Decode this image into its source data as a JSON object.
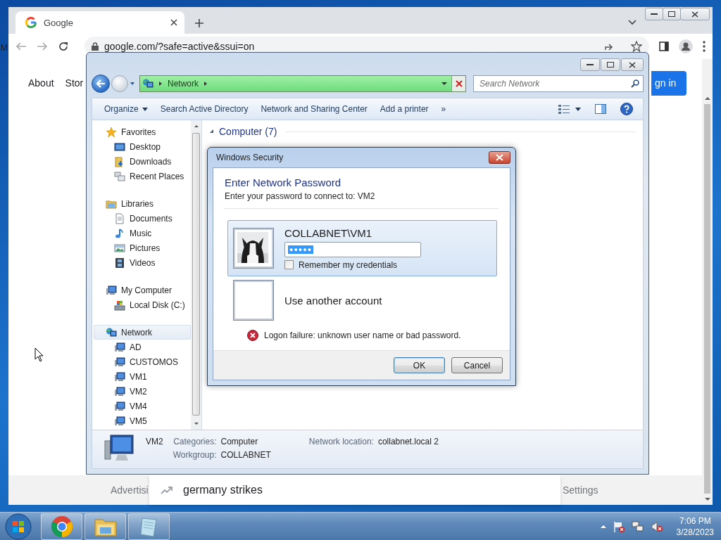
{
  "desktop": {
    "icon_label": "M"
  },
  "browser": {
    "tab_title": "Google",
    "address": "google.com/?safe=active&ssui=on",
    "nav_links": [
      "About",
      "Stor"
    ],
    "sign_in": "gn in",
    "footer_links": [
      "Advertisi",
      "Settings"
    ],
    "suggestion": "germany strikes"
  },
  "explorer": {
    "breadcrumb": "Network",
    "search_placeholder": "Search Network",
    "commands": [
      {
        "kind": "menu",
        "label": "Organize"
      },
      {
        "kind": "plain",
        "label": "Search Active Directory"
      },
      {
        "kind": "plain",
        "label": "Network and Sharing Center"
      },
      {
        "kind": "plain",
        "label": "Add a printer"
      },
      {
        "kind": "overflow",
        "label": "»"
      }
    ],
    "nav": [
      {
        "label": "Favorites",
        "kind": "star",
        "selected": false,
        "children": [
          {
            "label": "Desktop",
            "kind": "desktop",
            "selected": false
          },
          {
            "label": "Downloads",
            "kind": "downloads",
            "selected": false
          },
          {
            "label": "Recent Places",
            "kind": "recent",
            "selected": false
          }
        ]
      },
      {
        "label": "Libraries",
        "kind": "libraries",
        "selected": false,
        "children": [
          {
            "label": "Documents",
            "kind": "document",
            "selected": false
          },
          {
            "label": "Music",
            "kind": "music",
            "selected": false
          },
          {
            "label": "Pictures",
            "kind": "pictures",
            "selected": false
          },
          {
            "label": "Videos",
            "kind": "videos",
            "selected": false
          }
        ]
      },
      {
        "label": "My Computer",
        "kind": "computer",
        "selected": false,
        "children": [
          {
            "label": "Local Disk (C:)",
            "kind": "disk",
            "selected": false
          }
        ]
      },
      {
        "label": "Network",
        "kind": "network",
        "selected": true,
        "children": [
          {
            "label": "AD",
            "kind": "pc",
            "selected": false
          },
          {
            "label": "CUSTOMOS",
            "kind": "pc",
            "selected": false
          },
          {
            "label": "VM1",
            "kind": "pc",
            "selected": false
          },
          {
            "label": "VM2",
            "kind": "pc",
            "selected": false
          },
          {
            "label": "VM4",
            "kind": "pc",
            "selected": false
          },
          {
            "label": "VM5",
            "kind": "pc",
            "selected": false
          }
        ]
      }
    ],
    "group_header": "Computer (7)",
    "details": {
      "name": "VM2",
      "columns": [
        [
          {
            "label": "Categories:",
            "value": "Computer"
          },
          {
            "label": "Workgroup:",
            "value": "COLLABNET"
          }
        ],
        [
          {
            "label": "Network location:",
            "value": "collabnet.local 2"
          }
        ]
      ]
    }
  },
  "dialog": {
    "title": "Windows Security",
    "heading": "Enter Network Password",
    "subtitle": "Enter your password to connect to: VM2",
    "accounts": [
      {
        "kind": "user",
        "name": "COLLABNET\\VM1",
        "password": "●●●●●",
        "remember_label": "Remember my credentials",
        "remember_checked": false,
        "selected": true
      },
      {
        "kind": "other",
        "name": "Use another account",
        "selected": false
      }
    ],
    "error": "Logon failure: unknown user name or bad password.",
    "buttons": [
      {
        "label": "OK",
        "default": true
      },
      {
        "label": "Cancel",
        "default": false
      }
    ]
  },
  "taskbar": {
    "apps": [
      {
        "kind": "chrome"
      },
      {
        "kind": "explorer"
      },
      {
        "kind": "notepad"
      }
    ],
    "time": "7:06 PM",
    "date": "3/28/2023"
  }
}
